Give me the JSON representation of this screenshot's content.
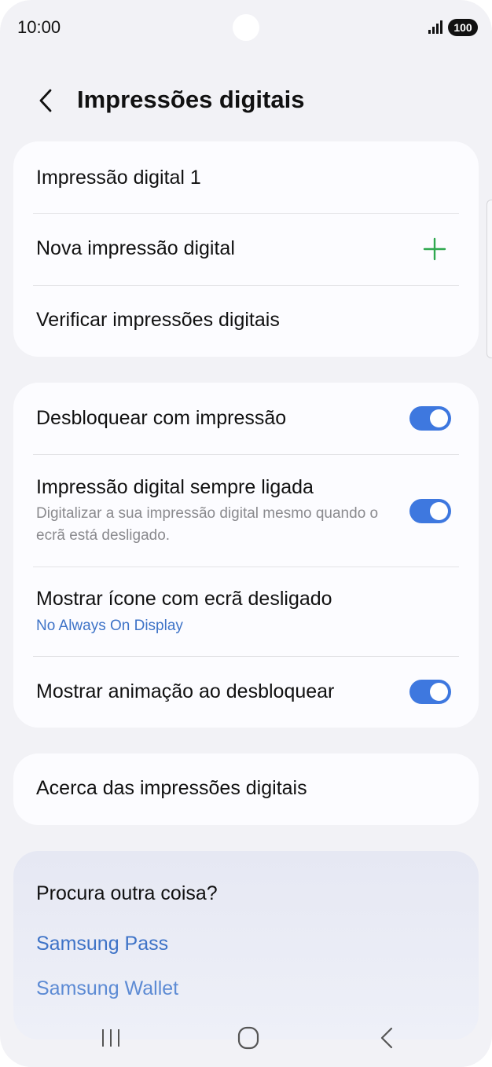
{
  "status_bar": {
    "time": "10:00",
    "battery": "100",
    "signal_icon": "signal-bars-icon",
    "battery_icon": "battery-icon"
  },
  "header": {
    "back_icon": "chevron-left-icon",
    "title": "Impressões digitais"
  },
  "fingerprints_card": {
    "items": [
      {
        "label": "Impressão digital 1"
      },
      {
        "label": "Nova impressão digital",
        "icon": "plus-icon"
      },
      {
        "label": "Verificar impressões digitais"
      }
    ]
  },
  "settings_card": {
    "items": [
      {
        "label": "Desbloquear com impressão",
        "toggle": true
      },
      {
        "label": "Impressão digital sempre ligada",
        "subtitle": "Digitalizar a sua impressão digital mesmo quando o ecrã está desligado.",
        "toggle": true
      },
      {
        "label": "Mostrar ícone com ecrã desligado",
        "subtitle": "No Always On Display"
      },
      {
        "label": "Mostrar animação ao desbloquear",
        "toggle": true
      }
    ]
  },
  "about_card": {
    "label": "Acerca das impressões digitais"
  },
  "suggestions": {
    "title": "Procura outra coisa?",
    "links": [
      {
        "label": "Samsung Pass"
      },
      {
        "label": "Samsung Wallet"
      }
    ]
  },
  "nav_bar": {
    "recents_icon": "recents-icon",
    "home_icon": "home-icon",
    "back_icon": "back-icon"
  },
  "colors": {
    "accent": "#3e78df",
    "link": "#3e73c7",
    "plus": "#2fa84f",
    "background": "#f2f2f6",
    "card": "#fcfcff"
  }
}
